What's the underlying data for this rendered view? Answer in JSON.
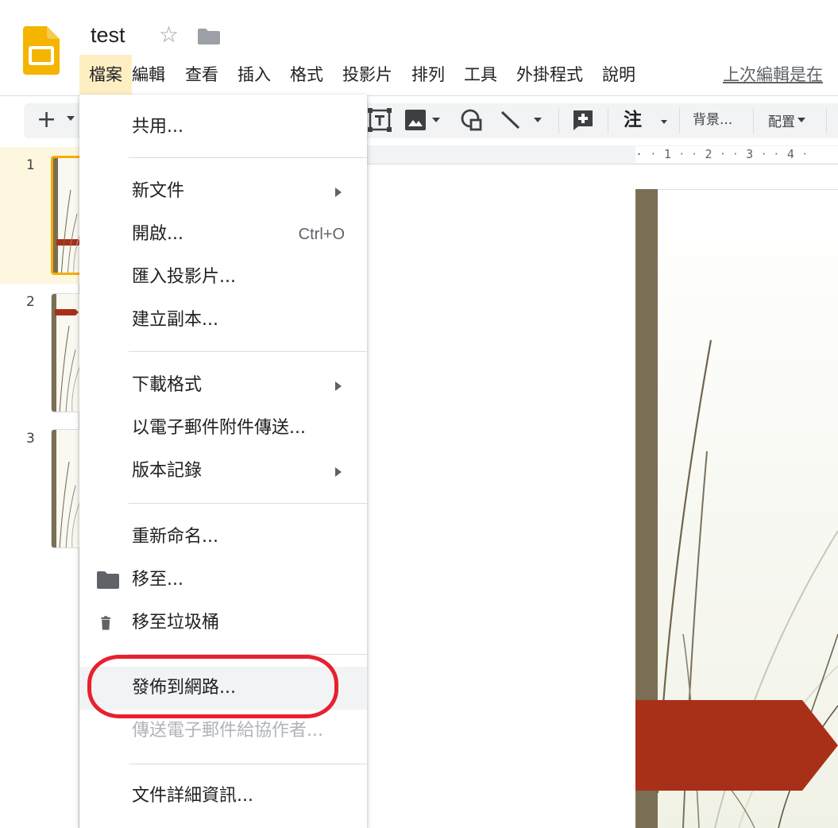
{
  "header": {
    "title": "test",
    "last_edit": "上次編輯是在"
  },
  "menubar": [
    {
      "label": "檔案",
      "active": true
    },
    {
      "label": "編輯"
    },
    {
      "label": "查看"
    },
    {
      "label": "插入"
    },
    {
      "label": "格式"
    },
    {
      "label": "投影片"
    },
    {
      "label": "排列"
    },
    {
      "label": "工具"
    },
    {
      "label": "外掛程式"
    },
    {
      "label": "說明"
    }
  ],
  "toolbar": {
    "insert_plus": "+",
    "comment_label": "注",
    "background_label": "背景...",
    "layout_label": "配置"
  },
  "ruler": {
    "ticks": "· ‧ 1 ‧ ‧ 2 ‧ ‧ 3 ‧ ‧ 4 ‧"
  },
  "filmstrip": {
    "slides": [
      {
        "number": "1",
        "selected": true
      },
      {
        "number": "2"
      },
      {
        "number": "3"
      }
    ]
  },
  "file_menu": {
    "share": "共用...",
    "new": "新文件",
    "open": "開啟...",
    "open_shortcut": "Ctrl+O",
    "import_slides": "匯入投影片...",
    "make_copy": "建立副本...",
    "download_as": "下載格式",
    "email_attachment": "以電子郵件附件傳送...",
    "version_history": "版本記錄",
    "rename": "重新命名...",
    "move_to": "移至...",
    "move_to_trash": "移至垃圾桶",
    "publish_to_web": "發佈到網路...",
    "email_collaborators": "傳送電子郵件給協作者...",
    "document_details": "文件詳細資訊..."
  },
  "colors": {
    "accent_yellow": "#f9ab00",
    "menu_active": "#feefc3",
    "highlight_red": "#e8202e",
    "slide_banner": "#a93018",
    "slide_bar": "#7a6f55"
  },
  "icons": [
    "app-logo-icon",
    "star-icon",
    "folder-icon",
    "text-box-icon",
    "image-icon",
    "shape-icon",
    "line-icon",
    "new-comment-icon",
    "trash-icon"
  ]
}
